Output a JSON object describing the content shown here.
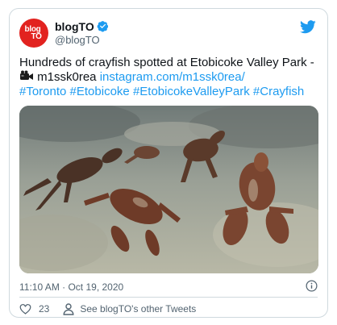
{
  "tweet": {
    "avatar": {
      "line1": "blog",
      "line2": "TO",
      "color": "#e2221f"
    },
    "display_name": "blogTO",
    "handle": "@blogTO",
    "verified": true,
    "text_plain": "Hundreds of crayfish spotted at Etobicoke Valley Park - ",
    "text_code": " m1ssk0rea ",
    "link": "instagram.com/m1ssk0rea/",
    "hashtags": [
      "#Toronto",
      "#Etobicoke",
      "#EtobicokeValleyPark",
      "#Crayfish"
    ],
    "timestamp": "11:10 AM · Oct 19, 2020",
    "likes": "23",
    "profile_link_label": "See blogTO's other Tweets",
    "media_description_icon": "crayfish-photo"
  },
  "icons": {
    "brand": "twitter-bird-icon",
    "verified": "verified-badge-icon",
    "camera": "video-camera-icon",
    "info": "info-icon",
    "like": "heart-icon",
    "profile": "person-icon"
  },
  "colors": {
    "accent": "#1d9bf0",
    "text": "#0f1419",
    "muted": "#536471",
    "border": "#cfd9de"
  }
}
